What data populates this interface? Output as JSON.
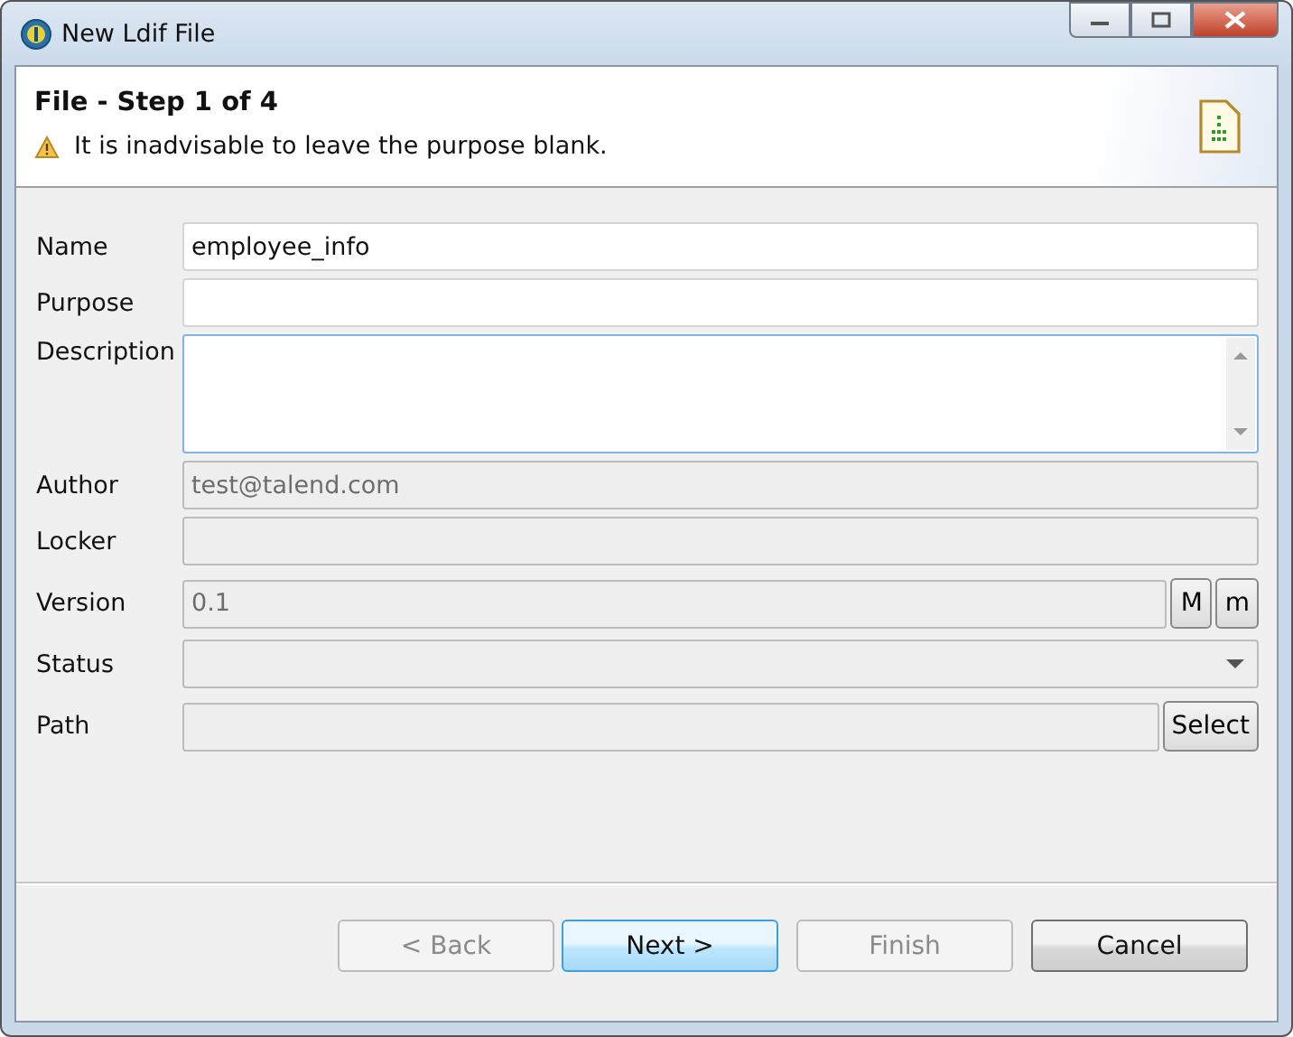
{
  "window": {
    "title": "New Ldif File"
  },
  "header": {
    "title": "File - Step 1 of 4",
    "message": "It is inadvisable to leave the purpose blank."
  },
  "fields": [
    {
      "label": "Name",
      "kind": "text",
      "value": "employee_info",
      "disabled": false,
      "focused": false
    },
    {
      "label": "Purpose",
      "kind": "text",
      "disabled": false,
      "focused": false
    },
    {
      "label": "Description",
      "kind": "textarea",
      "disabled": false,
      "focused": true
    },
    {
      "label": "Author",
      "kind": "text",
      "value": "test@talend.com",
      "disabled": true,
      "focused": false
    },
    {
      "label": "Locker",
      "kind": "text",
      "disabled": true,
      "focused": false
    },
    {
      "label": "Version",
      "kind": "version",
      "value": "0.1",
      "disabled": true,
      "focused": false,
      "buttons": [
        "M",
        "m"
      ]
    },
    {
      "label": "Status",
      "kind": "combo",
      "disabled": true,
      "focused": false
    },
    {
      "label": "Path",
      "kind": "path",
      "disabled": true,
      "focused": false,
      "buttons": [
        "Select"
      ]
    }
  ],
  "buttons": [
    {
      "label": "< Back",
      "disabled": true,
      "default": false
    },
    {
      "label": "Next >",
      "disabled": false,
      "default": true
    },
    {
      "label": "Finish",
      "disabled": true,
      "default": false
    },
    {
      "label": "Cancel",
      "disabled": false,
      "default": false
    }
  ]
}
